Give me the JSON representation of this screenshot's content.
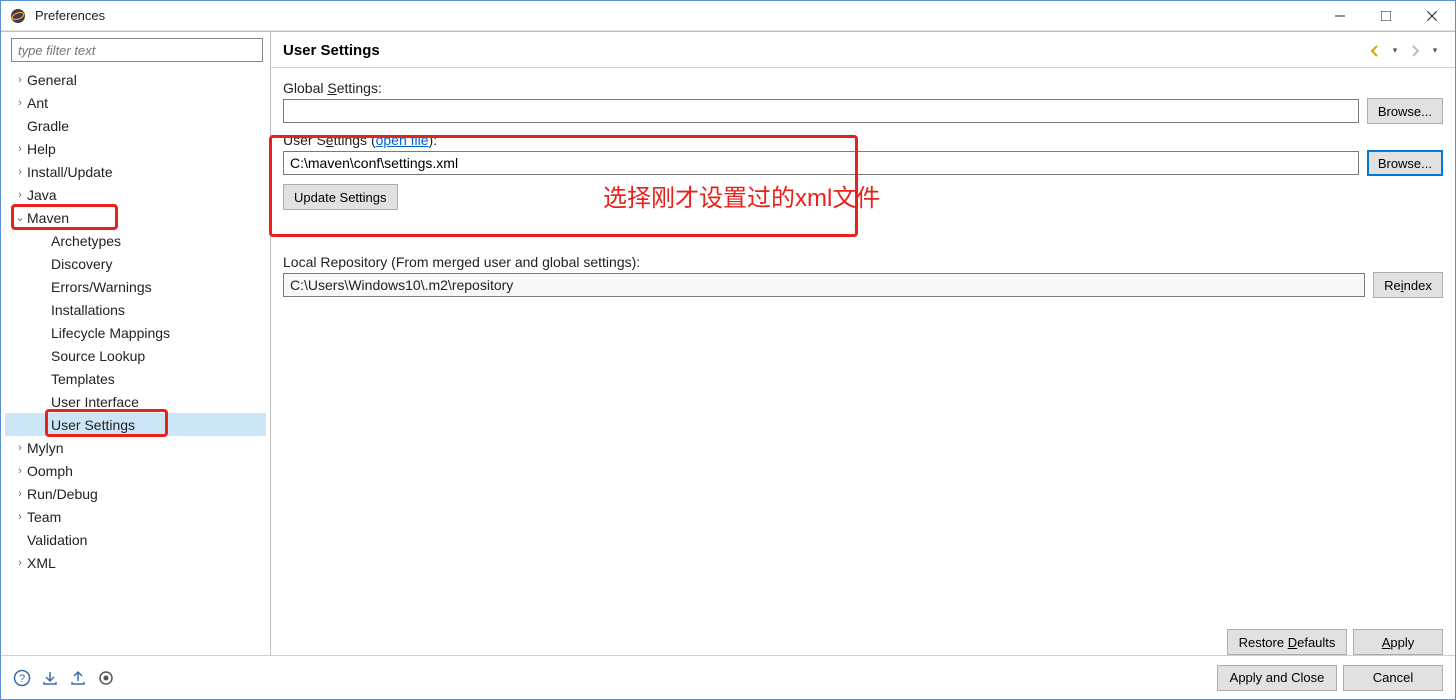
{
  "window": {
    "title": "Preferences"
  },
  "sidebar": {
    "filter_placeholder": "type filter text",
    "items": [
      {
        "label": "General",
        "arrow": ">"
      },
      {
        "label": "Ant",
        "arrow": ">"
      },
      {
        "label": "Gradle",
        "arrow": ""
      },
      {
        "label": "Help",
        "arrow": ">"
      },
      {
        "label": "Install/Update",
        "arrow": ">"
      },
      {
        "label": "Java",
        "arrow": ">"
      },
      {
        "label": "Maven",
        "arrow": "v",
        "highlighted": true,
        "children": [
          {
            "label": "Archetypes"
          },
          {
            "label": "Discovery"
          },
          {
            "label": "Errors/Warnings"
          },
          {
            "label": "Installations"
          },
          {
            "label": "Lifecycle Mappings"
          },
          {
            "label": "Source Lookup"
          },
          {
            "label": "Templates"
          },
          {
            "label": "User Interface"
          },
          {
            "label": "User Settings",
            "selected": true,
            "highlighted": true
          }
        ]
      },
      {
        "label": "Mylyn",
        "arrow": ">"
      },
      {
        "label": "Oomph",
        "arrow": ">"
      },
      {
        "label": "Run/Debug",
        "arrow": ">"
      },
      {
        "label": "Team",
        "arrow": ">"
      },
      {
        "label": "Validation",
        "arrow": ""
      },
      {
        "label": "XML",
        "arrow": ">"
      }
    ]
  },
  "main": {
    "heading": "User Settings",
    "global_label": "Global Settings:",
    "global_value": "",
    "global_browse": "Browse...",
    "user_label_pre": "User Settings (",
    "user_open_file": "open file",
    "user_label_post": "):",
    "user_value": "C:\\maven\\conf\\settings.xml",
    "user_browse": "Browse...",
    "update_btn": "Update Settings",
    "annotation": "选择刚才设置过的xml文件",
    "repo_label": "Local Repository (From merged user and global settings):",
    "repo_value": "C:\\Users\\Windows10\\.m2\\repository",
    "reindex_btn": "Reindex",
    "restore_btn": "Restore Defaults",
    "apply_btn": "Apply"
  },
  "footer": {
    "apply_close": "Apply and Close",
    "cancel": "Cancel"
  }
}
